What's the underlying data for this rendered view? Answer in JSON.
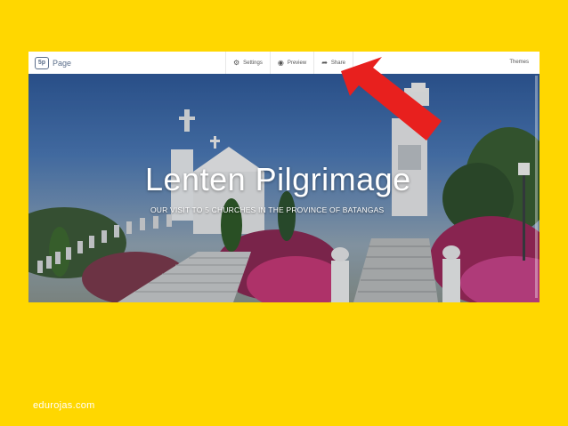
{
  "app": {
    "logo_badge": "5p",
    "title": "Page"
  },
  "toolbar": {
    "settings_label": "Settings",
    "preview_label": "Preview",
    "share_label": "Share",
    "themes_label": "Themes"
  },
  "hero": {
    "title": "Lenten Pilgrimage",
    "subtitle": "OUR VISIT TO 5 CHURCHES IN THE PROVINCE OF BATANGAS"
  },
  "footer": {
    "credit": "edurojas.com"
  },
  "colors": {
    "background": "#FFD700",
    "arrow": "#E8201E"
  }
}
